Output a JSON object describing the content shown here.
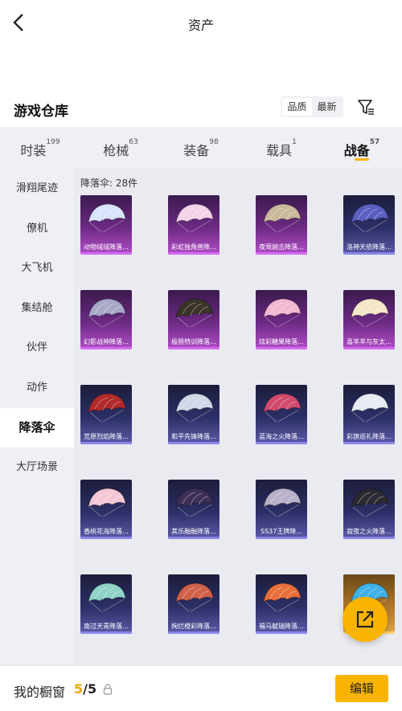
{
  "header": {
    "title": "资产",
    "back_icon": "chevron-left-icon"
  },
  "section": {
    "title": "游戏仓库",
    "sort": [
      "品质",
      "最新"
    ],
    "filter_icon": "filter-icon"
  },
  "tabs": [
    {
      "label": "时装",
      "count": "199"
    },
    {
      "label": "枪械",
      "count": "63"
    },
    {
      "label": "装备",
      "count": "98"
    },
    {
      "label": "载具",
      "count": "1"
    },
    {
      "label": "战备",
      "count": "57"
    }
  ],
  "sidebar": [
    "滑翔尾迹",
    "僚机",
    "大飞机",
    "集结舱",
    "伙伴",
    "动作",
    "降落伞",
    "大厅场景"
  ],
  "grid": {
    "count_label": "降落伞: 28件",
    "items": [
      {
        "name": "动物绒绒降落...",
        "rarity": "purple",
        "color": "#d8e4ff"
      },
      {
        "name": "彩虹独角兽降...",
        "rarity": "purple",
        "color": "#f4d3e8"
      },
      {
        "name": "夜莺婉吉降落...",
        "rarity": "purple",
        "color": "#c9b89a"
      },
      {
        "name": "洛神天依降落...",
        "rarity": "blue",
        "color": "#5a5fc0"
      },
      {
        "name": "幻影战神降落...",
        "rarity": "purple",
        "color": "#a8a8c8"
      },
      {
        "name": "极限特训降落...",
        "rarity": "purple",
        "color": "#3a3428"
      },
      {
        "name": "炫彩糖果降落...",
        "rarity": "purple",
        "color": "#f3b8d2"
      },
      {
        "name": "喜羊羊与灰太...",
        "rarity": "purple",
        "color": "#f5e6c8"
      },
      {
        "name": "荒原烈焰降落...",
        "rarity": "blue",
        "color": "#b22a2a"
      },
      {
        "name": "和平先锋降落...",
        "rarity": "blue",
        "color": "#cfd8e6"
      },
      {
        "name": "蓝海之火降落...",
        "rarity": "blue",
        "color": "#d04a6e"
      },
      {
        "name": "彩旗巡礼降落...",
        "rarity": "blue",
        "color": "#e6eaf2"
      },
      {
        "name": "香桃花海降落...",
        "rarity": "blue",
        "color": "#f5c7d6"
      },
      {
        "name": "其乐融融降落...",
        "rarity": "blue",
        "color": "#3d2f55"
      },
      {
        "name": "SS37王牌降...",
        "rarity": "blue",
        "color": "#b8b0c8"
      },
      {
        "name": "寂夜之火降落...",
        "rarity": "blue",
        "color": "#2b2a30"
      },
      {
        "name": "南过天青降落...",
        "rarity": "blue",
        "color": "#8fd3c8"
      },
      {
        "name": "绚烂橙彩降落...",
        "rarity": "blue",
        "color": "#d06048"
      },
      {
        "name": "福马献瑞降落...",
        "rarity": "blue",
        "color": "#e86e3a"
      },
      {
        "name": "",
        "rarity": "gold",
        "color": "#3fb0e8"
      }
    ]
  },
  "fab_icon": "share-external-icon",
  "footer": {
    "label": "我的橱窗",
    "current": "5",
    "separator": "/5",
    "lock_icon": "lock-icon",
    "edit": "编辑"
  }
}
